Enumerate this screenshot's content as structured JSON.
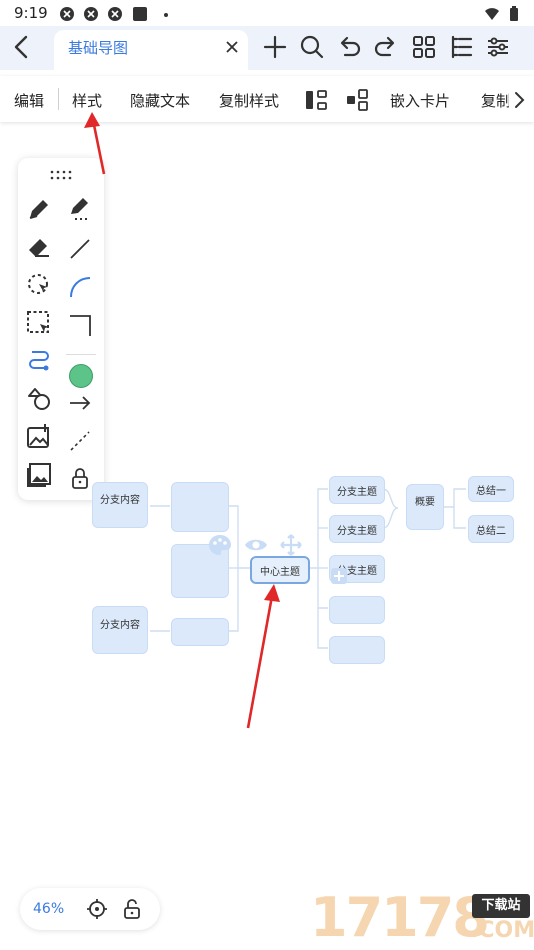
{
  "status": {
    "time": "9:19"
  },
  "tab": {
    "title": "基础导图"
  },
  "toolbar": {
    "items": [
      "编辑",
      "样式",
      "隐藏文本",
      "复制样式",
      "嵌入卡片",
      "复制"
    ]
  },
  "mindmap": {
    "center": "中心主题",
    "left_branches": [
      "分支内容",
      "分支内容"
    ],
    "right_topics": [
      "分支主题",
      "分支主题",
      "分支主题"
    ],
    "summary": "概要",
    "summary_items": [
      "总结一",
      "总结二"
    ]
  },
  "bottom": {
    "zoom": "46%"
  },
  "watermark": {
    "text": "17178",
    "badge": "下载站",
    "sub": ".COM"
  },
  "colors": {
    "accent": "#3b7be0",
    "node_fill": "#dbe9fb",
    "arrow": "#e02828",
    "fill_green": "#5cc389"
  }
}
